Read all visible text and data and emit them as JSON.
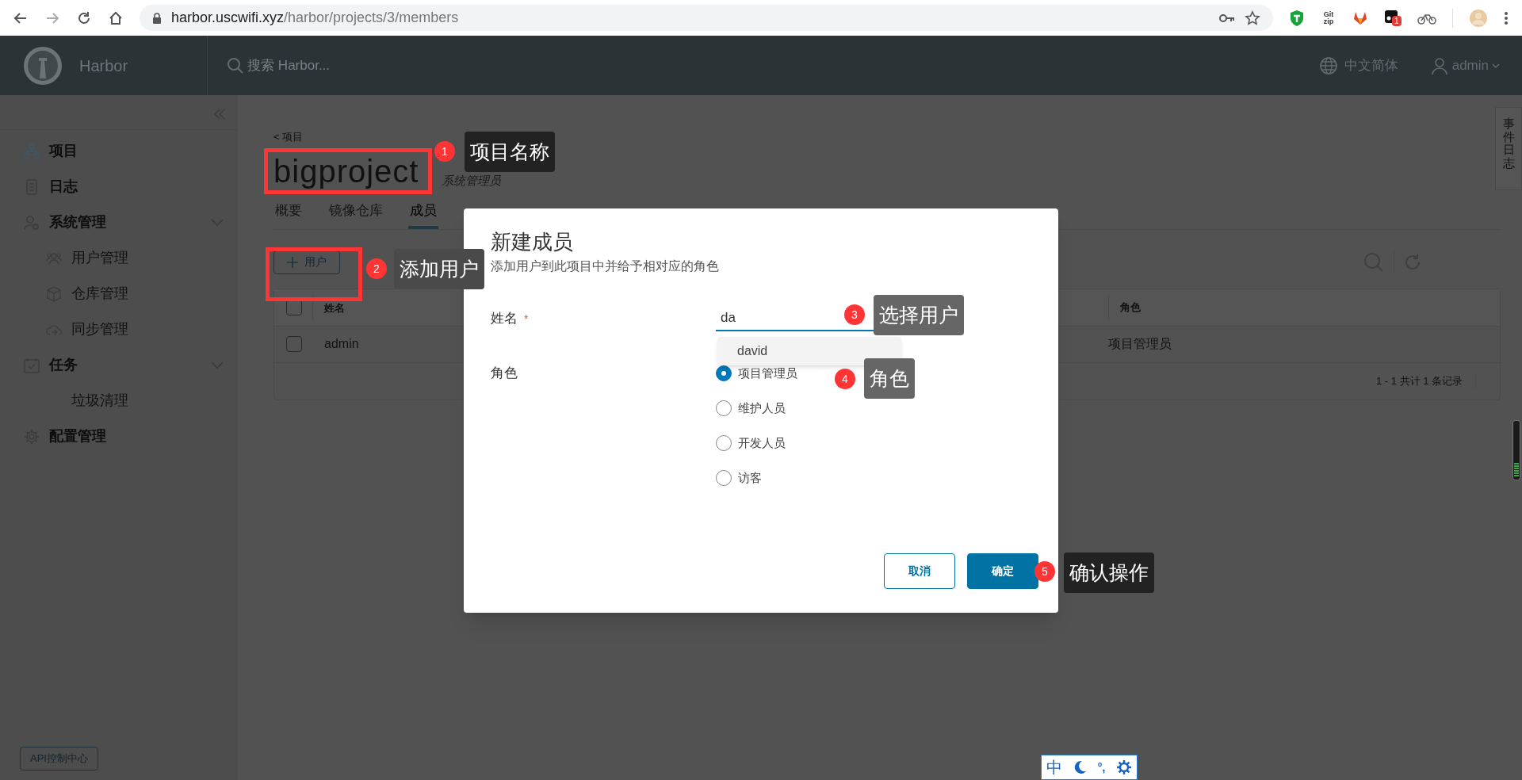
{
  "browser": {
    "url_host": "harbor.uscwifi.xyz",
    "url_path": "/harbor/projects/3/members",
    "extension_text": "Git zip",
    "extension_badge": "1"
  },
  "header": {
    "app_name": "Harbor",
    "search_placeholder": "搜索 Harbor...",
    "language": "中文简体",
    "user": "admin"
  },
  "sidebar": {
    "items": [
      {
        "label": "项目"
      },
      {
        "label": "日志"
      },
      {
        "label": "系统管理",
        "expanded": true,
        "children": [
          {
            "label": "用户管理"
          },
          {
            "label": "仓库管理"
          },
          {
            "label": "同步管理"
          }
        ]
      },
      {
        "label": "任务",
        "expanded": true,
        "children": [
          {
            "label": "垃圾清理"
          }
        ]
      },
      {
        "label": "配置管理"
      }
    ],
    "api_button": "API控制中心"
  },
  "project": {
    "breadcrumb": "< 项目",
    "name": "bigproject",
    "role": "系统管理员"
  },
  "tabs": [
    {
      "label": "概要",
      "selected": false
    },
    {
      "label": "镜像仓库",
      "selected": false
    },
    {
      "label": "成员",
      "selected": true
    }
  ],
  "add_user_button": "用户",
  "table": {
    "select_all_checked": false,
    "columns": [
      "姓名",
      "角色"
    ],
    "rows": [
      {
        "name": "admin",
        "role": "项目管理员",
        "checked": false
      }
    ],
    "footer": "1 - 1 共计 1 条记录"
  },
  "event_log_tab": "事件日志",
  "modal": {
    "title": "新建成员",
    "subtitle": "添加用户到此项目中并给予相对应的角色",
    "name_label": "姓名",
    "required_mark": "*",
    "name_value": "da",
    "suggestions": [
      "david"
    ],
    "role_label": "角色",
    "roles": [
      {
        "label": "项目管理员",
        "selected": true
      },
      {
        "label": "维护人员",
        "selected": false
      },
      {
        "label": "开发人员",
        "selected": false
      },
      {
        "label": "访客",
        "selected": false
      }
    ],
    "buttons": [
      {
        "label": "取消",
        "kind": "secondary"
      },
      {
        "label": "确定",
        "kind": "primary"
      }
    ]
  },
  "annotations": [
    {
      "number": "1",
      "label": "项目名称"
    },
    {
      "number": "2",
      "label": "添加用户"
    },
    {
      "number": "3",
      "label": "选择用户"
    },
    {
      "number": "4",
      "label": "角色"
    },
    {
      "number": "5",
      "label": "确认操作"
    }
  ],
  "ime_bar": {
    "mode": "中",
    "punctuation": "°,"
  }
}
